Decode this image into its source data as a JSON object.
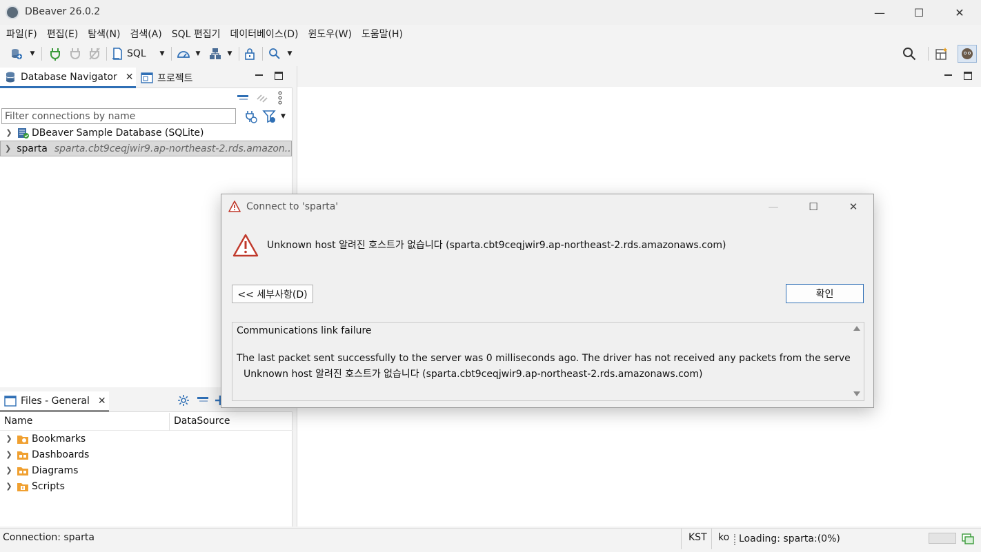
{
  "app": {
    "title": "DBeaver 26.0.2",
    "window_controls": {
      "minimize": "—",
      "maximize": "☐",
      "close": "✕"
    }
  },
  "menu": [
    "파일(F)",
    "편집(E)",
    "탐색(N)",
    "검색(A)",
    "SQL 편집기",
    "데이터베이스(D)",
    "윈도우(W)",
    "도움말(H)"
  ],
  "toolbar": {
    "sql_label": "SQL"
  },
  "navigator": {
    "tab_label": "Database Navigator",
    "project_tab_label": "프로젝트",
    "filter_placeholder": "Filter connections by name",
    "items": [
      {
        "label": "DBeaver Sample Database (SQLite)",
        "sub": ""
      },
      {
        "label": "sparta",
        "sub": "sparta.cbt9ceqjwir9.ap-northeast-2.rds.amazon..."
      }
    ]
  },
  "files": {
    "tab_label": "Files - General",
    "columns": [
      "Name",
      "DataSource"
    ],
    "items": [
      "Bookmarks",
      "Dashboards",
      "Diagrams",
      "Scripts"
    ]
  },
  "dialog": {
    "title": "Connect to 'sparta'",
    "message": "Unknown host 알려진 호스트가 없습니다 (sparta.cbt9ceqjwir9.ap-northeast-2.rds.amazonaws.com)",
    "details_button": "<< 세부사항(D)",
    "ok_button": "확인",
    "details": {
      "line1": "Communications link failure",
      "line2": "The last packet sent successfully to the server was 0 milliseconds ago. The driver has not received any packets from the server.",
      "line3": "Unknown host 알려진 호스트가 없습니다 (sparta.cbt9ceqjwir9.ap-northeast-2.rds.amazonaws.com)"
    }
  },
  "status": {
    "connection": "Connection: sparta",
    "timezone": "KST",
    "locale": "ko",
    "loading": "Loading: sparta:(0%)"
  },
  "colors": {
    "accent": "#2f6fb5",
    "warning": "#c0392b",
    "folder": "#f0a030"
  }
}
